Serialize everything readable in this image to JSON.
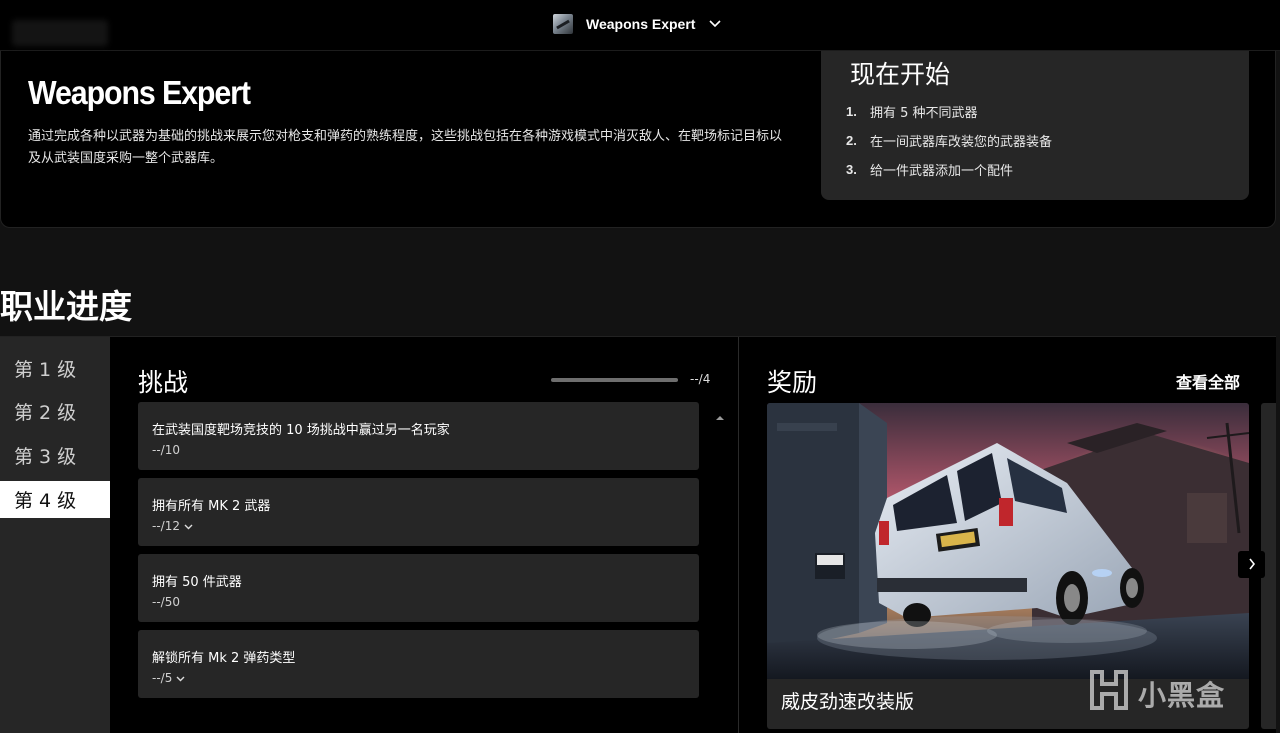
{
  "topbar": {
    "game_title": "Weapons Expert",
    "selector_icon": "chevron-down-icon"
  },
  "hero": {
    "title": "Weapons Expert",
    "description": "通过完成各种以武器为基础的挑战来展示您对枪支和弹药的熟练程度，这些挑战包括在各种游戏模式中消灭敌人、在靶场标记目标以及从武装国度采购一整个武器库。"
  },
  "start": {
    "heading": "现在开始",
    "steps": [
      {
        "num": "1.",
        "text": "拥有 5 种不同武器"
      },
      {
        "num": "2.",
        "text": "在一间武器库改装您的武器装备"
      },
      {
        "num": "3.",
        "text": "给一件武器添加一个配件"
      }
    ]
  },
  "career": {
    "heading": "职业进度",
    "levels": [
      "第 1 级",
      "第 2 级",
      "第 3 级",
      "第 4 级"
    ],
    "active_level_index": 3
  },
  "challenges": {
    "heading": "挑战",
    "progress_label": "--/4",
    "progress_fraction": 0,
    "items": [
      {
        "title": "在武装国度靶场竞技的 10 场挑战中赢过另一名玩家",
        "count": "--/10",
        "expandable": false
      },
      {
        "title": "拥有所有 MK 2 武器",
        "count": "--/12",
        "expandable": true
      },
      {
        "title": "拥有 50 件武器",
        "count": "--/50",
        "expandable": false
      },
      {
        "title": "解锁所有 Mk 2 弹药类型",
        "count": "--/5",
        "expandable": true
      }
    ]
  },
  "rewards": {
    "heading": "奖励",
    "view_all": "查看全部",
    "item_name": "威皮劲速改装版"
  },
  "watermark": {
    "text": "小黑盒"
  },
  "colors": {
    "background": "#121212",
    "panel": "#000000",
    "card": "#262626",
    "active_level": "#ffffff"
  }
}
